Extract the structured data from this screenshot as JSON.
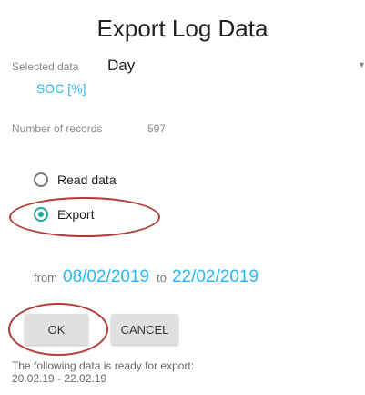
{
  "dialog": {
    "title": "Export Log Data"
  },
  "selection": {
    "label": "Selected data",
    "value": "Day",
    "dropdown_icon": "triangle-down",
    "sub_value": "SOC [%]"
  },
  "records": {
    "label": "Number of records",
    "value": "597"
  },
  "options": [
    {
      "label": "Read data",
      "checked": false
    },
    {
      "label": "Export",
      "checked": true
    }
  ],
  "range": {
    "from_word": "from",
    "from_date": "08/02/2019",
    "to_word": "to",
    "to_date": "22/02/2019"
  },
  "buttons": {
    "ok": "OK",
    "cancel": "CANCEL"
  },
  "footer": {
    "line1": "The following data is ready for export:",
    "line2": "20.02.19 - 22.02.19"
  },
  "colors": {
    "accent": "#29b6f6",
    "radio_checked": "#26a69a",
    "highlight": "#b23a3a"
  }
}
